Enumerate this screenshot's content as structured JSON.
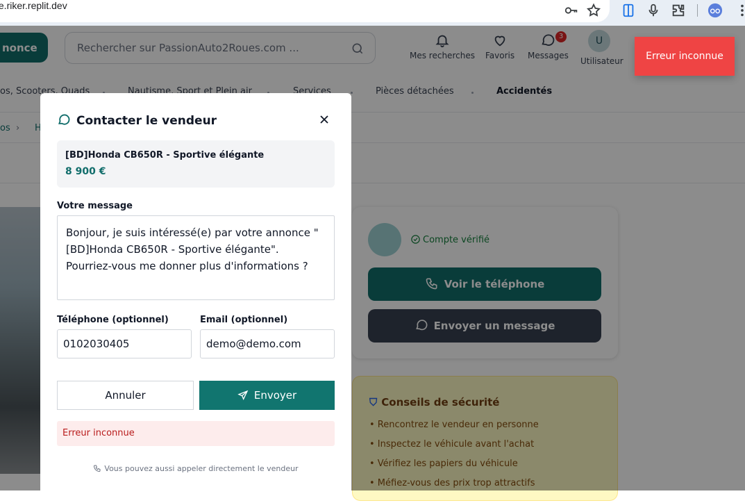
{
  "browser": {
    "url": "kyte.riker.replit.dev",
    "icons": [
      "key-icon",
      "star-icon",
      "sidebar-icon",
      "mic-icon",
      "extensions-icon",
      "profile-icon",
      "more-icon"
    ]
  },
  "header": {
    "post_button": "nonce",
    "search_placeholder": "Rechercher sur PassionAuto2Roues.com ...",
    "nav": {
      "searches": "Mes recherches",
      "favorites": "Favoris",
      "messages": "Messages",
      "messages_badge": "3",
      "user": "Utilisateur",
      "avatar_letter": "U"
    }
  },
  "toast": {
    "text": "Erreur inconnue",
    "color": "#ef4444"
  },
  "categories": [
    "os, Scooters, Quads",
    "Nautisme, Sport et Plein air",
    "Services",
    "Pièces détachées",
    "Accidentés"
  ],
  "breadcrumb": [
    "os",
    "H"
  ],
  "seller_card": {
    "verified": "Compte vérifié",
    "phone_button": "Voir le téléphone",
    "message_button": "Envoyer un message"
  },
  "safety": {
    "title": "Conseils de sécurité",
    "tips": [
      "• Rencontrez le vendeur en personne",
      "• Inspectez le véhicule avant l'achat",
      "• Vérifiez les papiers du véhicule",
      "• Méfiez-vous des prix trop attractifs"
    ]
  },
  "modal": {
    "title": "Contacter le vendeur",
    "listing_title": "[BD]Honda CB650R - Sportive élégante",
    "listing_price": "8 900 €",
    "message_label": "Votre message",
    "message_value": "Bonjour, je suis intéressé(e) par votre annonce \"[BD]Honda CB650R - Sportive élégante\". Pourriez-vous me donner plus d'informations ?",
    "phone_label": "Téléphone (optionnel)",
    "phone_value": "0102030405",
    "email_label": "Email (optionnel)",
    "email_value": "demo@demo.com",
    "cancel": "Annuler",
    "send": "Envoyer",
    "error": "Erreur inconnue",
    "footnote": "Vous pouvez aussi appeler directement le vendeur"
  },
  "colors": {
    "brand": "#116d6b",
    "error": "#b91c1c"
  }
}
